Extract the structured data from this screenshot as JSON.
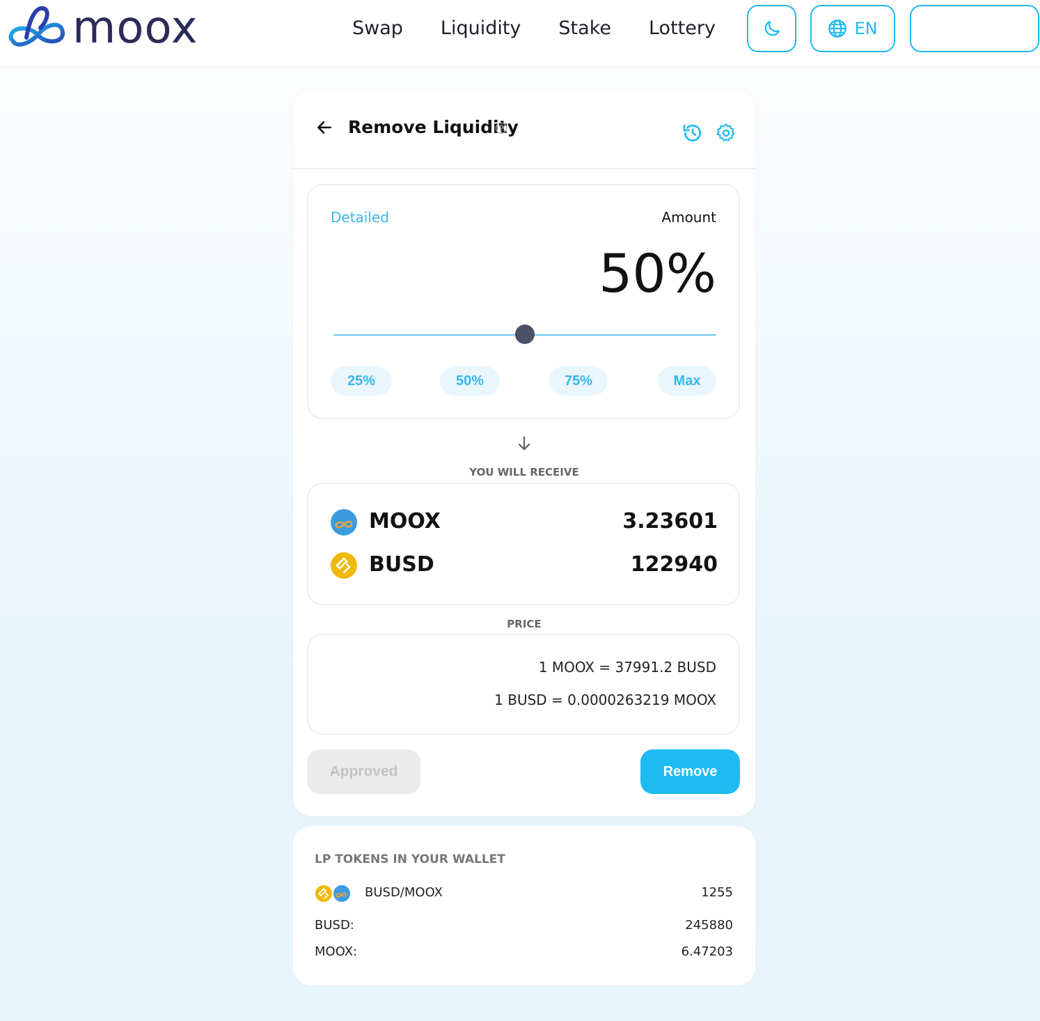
{
  "brand": {
    "name": "moox",
    "primary_color": "#1fbaf0",
    "text_color": "#2a2c58"
  },
  "nav": {
    "items": [
      {
        "label": "Swap"
      },
      {
        "label": "Liquidity"
      },
      {
        "label": "Stake"
      },
      {
        "label": "Lottery"
      }
    ]
  },
  "header_buttons": {
    "theme_icon": "moon-icon",
    "language": "EN",
    "language_icon": "globe-icon",
    "wallet_label": ""
  },
  "remove_card": {
    "title": "Remove Liquidity",
    "detailed_link": "Detailed",
    "amount_label": "Amount",
    "amount_value": "50%",
    "slider_percent": 50,
    "presets": [
      "25%",
      "50%",
      "75%",
      "Max"
    ],
    "receive_label": "YOU WILL RECEIVE",
    "receive": [
      {
        "token": "MOOX",
        "amount": "3.23601",
        "icon": "moox-token-icon"
      },
      {
        "token": "BUSD",
        "amount": "122940",
        "icon": "busd-token-icon"
      }
    ],
    "price_label": "PRICE",
    "price_lines": [
      "1 MOOX = 37991.2 BUSD",
      "1 BUSD = 0.0000263219 MOOX"
    ],
    "approved_button": "Approved",
    "remove_button": "Remove"
  },
  "lp_card": {
    "title": "LP TOKENS IN YOUR WALLET",
    "pair_label": "BUSD/MOOX",
    "pair_amount": "1255",
    "rows": [
      {
        "label": "BUSD:",
        "value": "245880"
      },
      {
        "label": "MOOX:",
        "value": "6.47203"
      }
    ]
  }
}
